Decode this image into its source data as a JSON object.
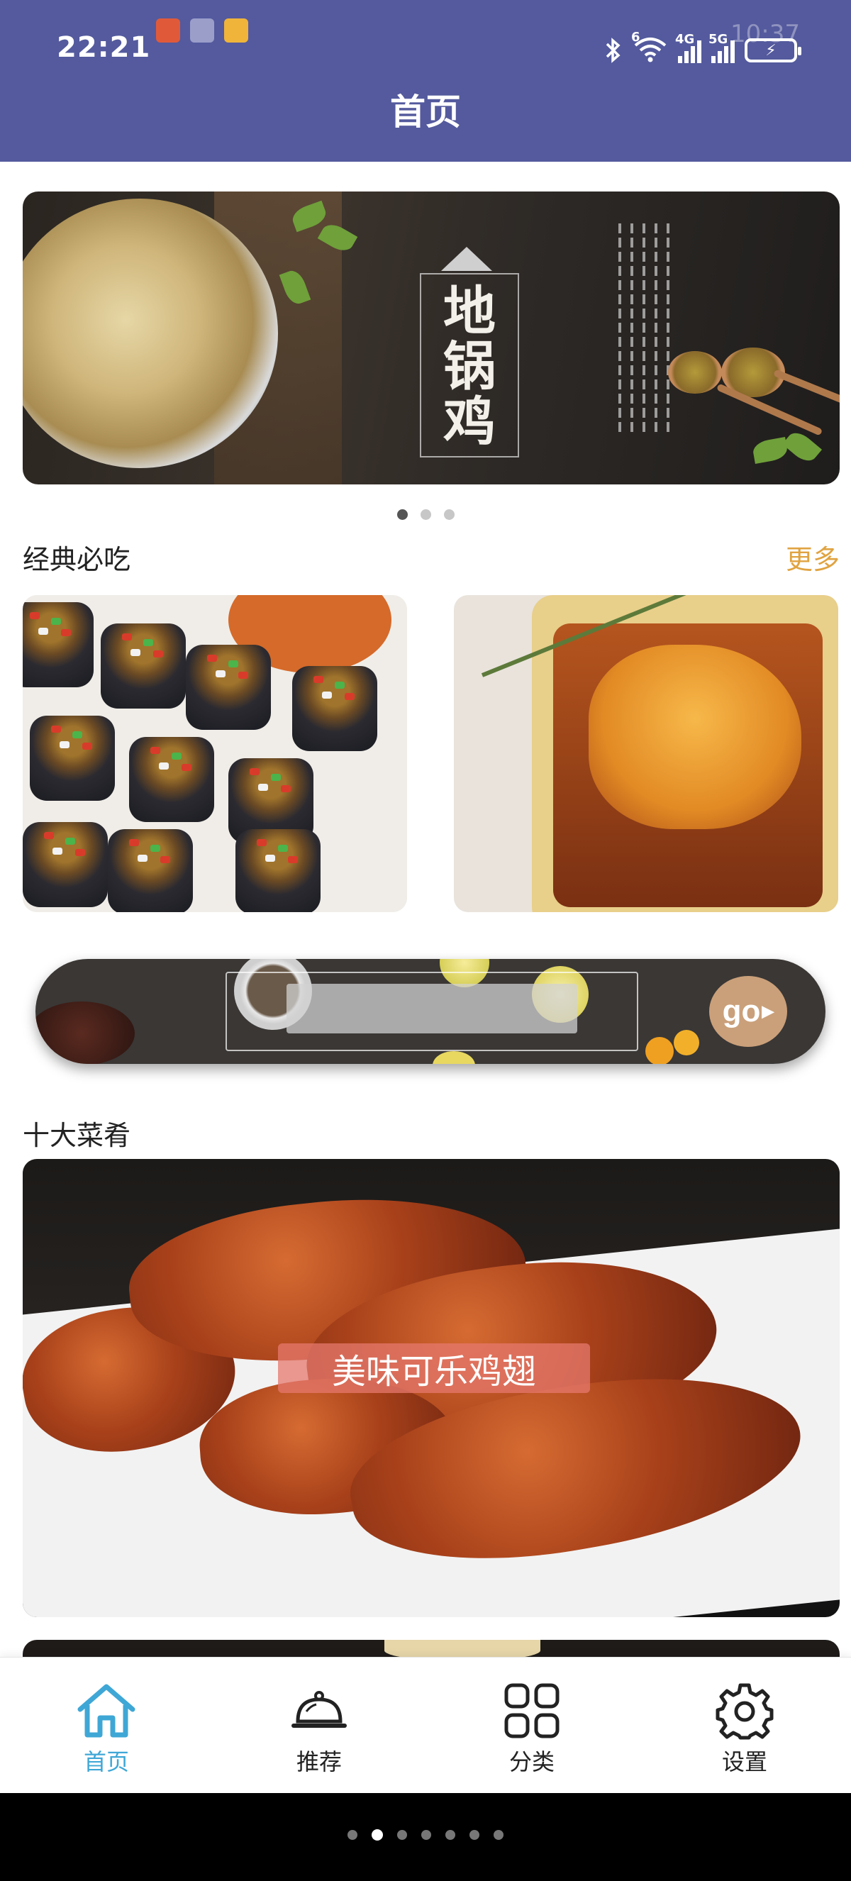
{
  "status_bar": {
    "time": "22:21",
    "ghost_time": "10:37",
    "wifi_badge": "6",
    "network_1": "4G",
    "network_2": "5G",
    "notification_icons": [
      "huawei-health-icon",
      "huawei-mail-icon",
      "folder-icon"
    ]
  },
  "header": {
    "title": "首页"
  },
  "banner": {
    "title": "地锅鸡",
    "active_slide": 1,
    "slide_count": 3
  },
  "classic": {
    "title": "经典必吃",
    "more_label": "更多",
    "dishes": [
      {
        "image": "stuffed-eggplant-photo"
      },
      {
        "image": "cheese-baked-chop-photo"
      }
    ]
  },
  "search": {
    "go_label": "go",
    "placeholder": "",
    "value": ""
  },
  "top_ten": {
    "title": "十大菜肴",
    "featured": {
      "label": "美味可乐鸡翅",
      "image": "cola-chicken-wings-photo"
    }
  },
  "bottom_nav": {
    "items": [
      {
        "label": "首页",
        "icon": "home-icon",
        "active": true
      },
      {
        "label": "推荐",
        "icon": "cloche-icon",
        "active": false
      },
      {
        "label": "分类",
        "icon": "grid-icon",
        "active": false
      },
      {
        "label": "设置",
        "icon": "gear-icon",
        "active": false
      }
    ]
  },
  "system_nav": {
    "page_count": 7,
    "active_page": 2
  },
  "colors": {
    "header_bg": "#545a9d",
    "accent_more": "#e0a341",
    "nav_active": "#3fa7d6"
  }
}
